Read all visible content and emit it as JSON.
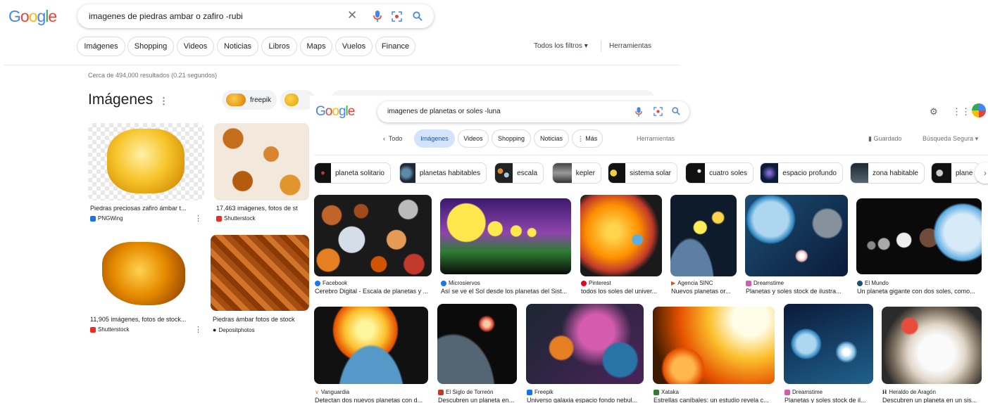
{
  "back": {
    "logo": "Google",
    "query": "imagenes de piedras ambar o zafiro -rubi",
    "tabs": [
      "Imágenes",
      "Shopping",
      "Videos",
      "Noticias",
      "Libros",
      "Maps",
      "Vuelos",
      "Finance"
    ],
    "filters": "Todos los filtros",
    "tools": "Herramientas",
    "stats": "Cerca de 494,000 resultados (0.21 segundos)",
    "section_title": "Imágenes",
    "chip_freepik": "freepik",
    "results": [
      {
        "caption": "Piedras preciosas zafiro ámbar t...",
        "source": "PNGWing"
      },
      {
        "caption": "17,463 imágenes, fotos de st",
        "source": "Shutterstock"
      },
      {
        "caption": "11,905 imágenes, fotos de stock...",
        "source": "Shutterstock"
      },
      {
        "caption": "Piedras ámbar fotos de stock",
        "source": "Depositphotos"
      }
    ]
  },
  "front": {
    "logo": "Google",
    "query": "imagenes de planetas or soles -luna",
    "tabs": {
      "all": "Todo",
      "images": "Imágenes",
      "videos": "Videos",
      "shopping": "Shopping",
      "news": "Noticias",
      "more": "Más"
    },
    "tools": "Herramientas",
    "saved": "Guardado",
    "safe": "Búsqueda Segura",
    "suggestions": [
      "planeta solitario",
      "planetas habitables",
      "escala",
      "kepler",
      "sistema solar",
      "cuatro soles",
      "espacio profundo",
      "zona habitable",
      "plane"
    ],
    "row1": [
      {
        "source": "Facebook",
        "caption": "Cerebro Digital - Escala de planetas y ..."
      },
      {
        "source": "Microsiervos",
        "caption": "Así se ve el Sol desde los planetas del Sist..."
      },
      {
        "source": "Pinterest",
        "caption": "todos los soles del univer..."
      },
      {
        "source": "Agencia SINC",
        "caption": "Nuevos planetas or..."
      },
      {
        "source": "Dreamstime",
        "caption": "Planetas y soles stock de ilustra..."
      },
      {
        "source": "El Mundo",
        "caption": "Un planeta gigante con dos soles, como..."
      }
    ],
    "row2": [
      {
        "source": "Vanguardia",
        "caption": "Detectan dos nuevos planetas con d..."
      },
      {
        "source": "El Siglo de Torreón",
        "caption": "Descubren un planeta en..."
      },
      {
        "source": "Freepik",
        "caption": "Universo galaxia espacio fondo nebul..."
      },
      {
        "source": "Xataka",
        "caption": "Estrellas caníbales: un estudio revela c..."
      },
      {
        "source": "Dreamstime",
        "caption": "Planetas y soles stock de il..."
      },
      {
        "source": "Heraldo de Aragón",
        "caption": "Descubren un planeta en un sis..."
      }
    ]
  }
}
